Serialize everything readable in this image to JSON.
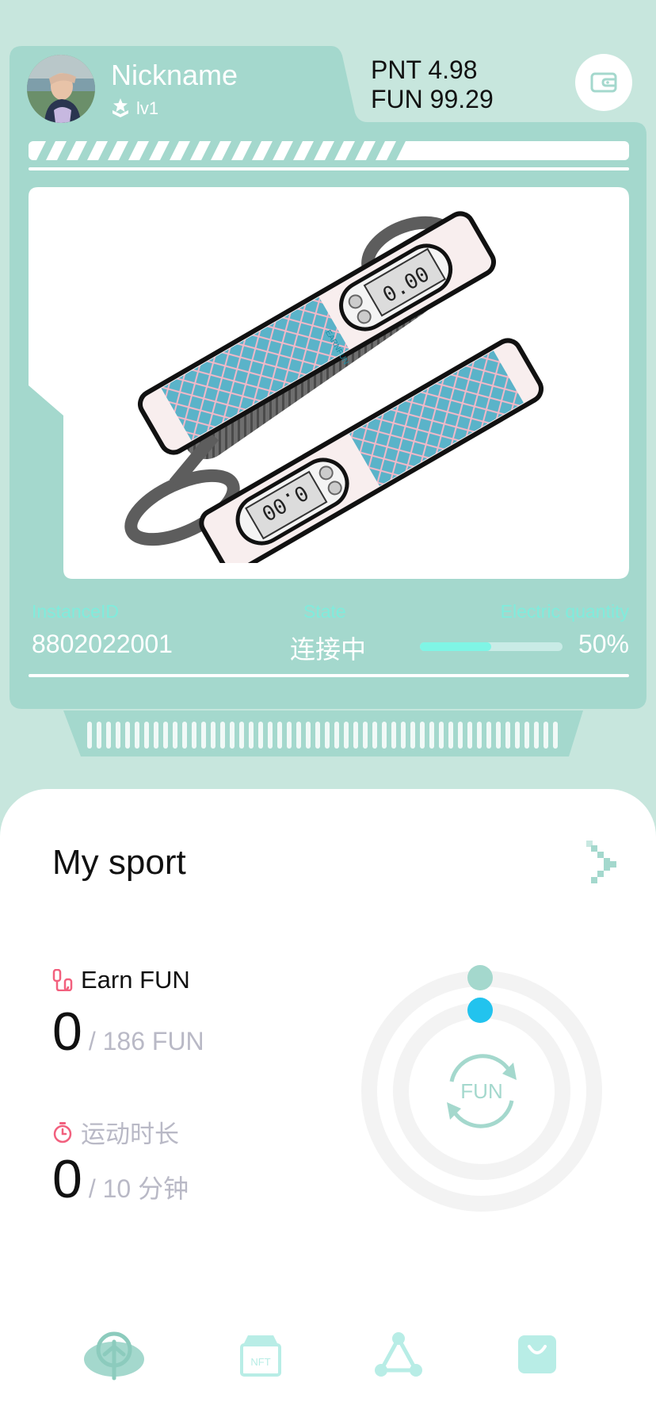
{
  "profile": {
    "nickname": "Nickname",
    "level": "lv1"
  },
  "balances": {
    "pnt": "PNT 4.98",
    "fun": "FUN 99.29"
  },
  "device": {
    "instance_label": "InstanceID",
    "instance_value": "8802022001",
    "state_label": "State",
    "state_value": "连接中",
    "battery_label": "Electric quantity",
    "battery_value": "50%",
    "battery_level": 0.5,
    "lcd_text": "0.00"
  },
  "sport": {
    "title": "My sport",
    "earn_label": "Earn FUN",
    "earn_value": "0",
    "earn_goal": "/ 186 FUN",
    "duration_label": "运动时长",
    "duration_value": "0",
    "duration_goal": "/ 10 分钟",
    "ring_label": "FUN"
  },
  "colors": {
    "page_bg": "#c7e6dd",
    "card": "#a4d8cd",
    "accent": "#80ecdc",
    "battery_fill": "#7ff5e5",
    "ring_dot_teal": "#a4d8cd",
    "ring_dot_blue": "#22c3ee",
    "icon_pink": "#f2607e"
  },
  "nav": [
    {
      "name": "home",
      "icon": "running-person-icon"
    },
    {
      "name": "nft",
      "icon": "nft-box-icon"
    },
    {
      "name": "network",
      "icon": "triangle-network-icon"
    },
    {
      "name": "shop",
      "icon": "shopping-bag-icon"
    }
  ]
}
